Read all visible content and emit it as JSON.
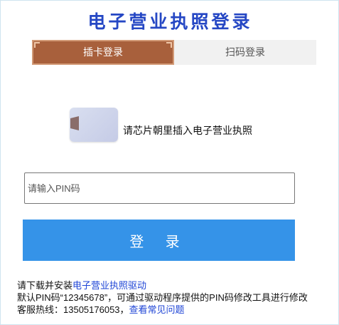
{
  "title": "电子营业执照登录",
  "tabs": [
    {
      "label": "插卡登录",
      "active": true
    },
    {
      "label": "扫码登录",
      "active": false
    }
  ],
  "card_section": {
    "instruction": "请芯片朝里插入电子营业执照",
    "icon": "card-icon"
  },
  "pin": {
    "placeholder": "请输入PIN码",
    "value": ""
  },
  "login_button": {
    "label": "登 录"
  },
  "notes": {
    "line1_prefix": "请下载并安装",
    "driver_link": "电子营业执照驱动",
    "line2": "默认PIN码“12345678”，可通过驱动程序提供的PIN码修改工具进行修改",
    "line3_prefix": "客服热线：13505176053，",
    "faq_link": "查看常见问题"
  },
  "colors": {
    "title": "#2547c4",
    "tab_active_bg": "#a8603c",
    "tab_inactive_bg": "#f1f1f1",
    "button_bg": "#3593e8",
    "link": "#1f45d6"
  }
}
